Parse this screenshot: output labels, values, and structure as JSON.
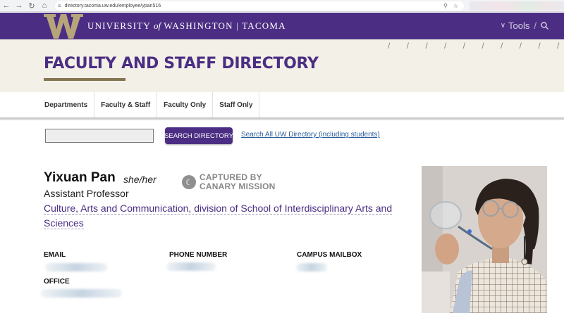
{
  "browser": {
    "url": "directory.tacoma.uw.edu/employee/ypan516"
  },
  "header": {
    "university_prefix": "UNIVERSITY",
    "university_of": "of",
    "university_suffix": "WASHINGTON | TACOMA",
    "tools_label": "Tools",
    "brand_color": "#4b2e83",
    "gold_color": "#b7a57a"
  },
  "banner": {
    "title": "FACULTY AND STAFF DIRECTORY"
  },
  "nav": {
    "tabs": [
      "Departments",
      "Faculty & Staff",
      "Faculty Only",
      "Staff Only"
    ]
  },
  "search": {
    "input_value": "",
    "button_label": "SEARCH DIRECTORY",
    "all_link": "Search All UW Directory (including students)"
  },
  "person": {
    "name": "Yixuan Pan",
    "pronouns": "she/her",
    "captured_line1": "CAPTURED BY",
    "captured_line2": "CANARY MISSION",
    "title": "Assistant Professor",
    "department": "Culture, Arts and Communication, division of School of Interdisciplinary Arts and Sciences"
  },
  "contact": {
    "email_label": "EMAIL",
    "phone_label": "PHONE NUMBER",
    "mailbox_label": "CAMPUS MAILBOX",
    "office_label": "OFFICE"
  },
  "icons": {
    "back": "back-arrow-icon",
    "forward": "forward-arrow-icon",
    "reload": "reload-icon",
    "home": "home-icon",
    "site_info": "tune-icon",
    "zoom": "zoom-icon",
    "bookmark": "star-icon",
    "tools_chevron": "chevron-down-icon",
    "search": "search-icon",
    "canary": "canary-icon"
  }
}
